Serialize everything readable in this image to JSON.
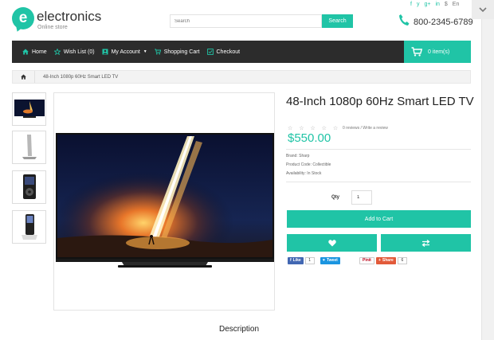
{
  "header": {
    "logo_letter": "e",
    "logo_name": "electronics",
    "logo_sub": "Online store",
    "search_placeholder": "Search",
    "search_button": "Search",
    "social": [
      "f",
      "y",
      "g+",
      "in"
    ],
    "currency": "$",
    "language": "En",
    "phone": "800-2345-6789"
  },
  "nav": {
    "items": [
      {
        "label": "Home",
        "icon": "home-icon"
      },
      {
        "label": "Wish List (0)",
        "icon": "star-icon"
      },
      {
        "label": "My Account",
        "icon": "user-icon"
      },
      {
        "label": "Shopping Cart",
        "icon": "cart-icon"
      },
      {
        "label": "Checkout",
        "icon": "checkout-icon"
      }
    ],
    "cart_label": "0 item(s)"
  },
  "breadcrumb": {
    "current": "48-Inch 1080p 60Hz Smart LED TV"
  },
  "product": {
    "title": "48-Inch 1080p 60Hz Smart LED TV",
    "stars": "☆ ☆ ☆ ☆ ☆",
    "rating": 0,
    "reviews_text": "0 reviews / Write a review",
    "price": "$550.00",
    "brand": "Brand: Sharp",
    "code": "Product Code: Collectible",
    "availability": "Availability: In Stock",
    "qty_label": "Qty",
    "qty_value": "1",
    "add_to_cart": "Add to Cart"
  },
  "share": {
    "like_label": "Like",
    "like_count": "1",
    "tweet_label": "Tweet",
    "pin_label": "Pinit",
    "share_label": "Share",
    "share_count": "6"
  },
  "description_title": "Description",
  "colors": {
    "accent": "#20c4a6",
    "navbar": "#2c2c2c"
  }
}
